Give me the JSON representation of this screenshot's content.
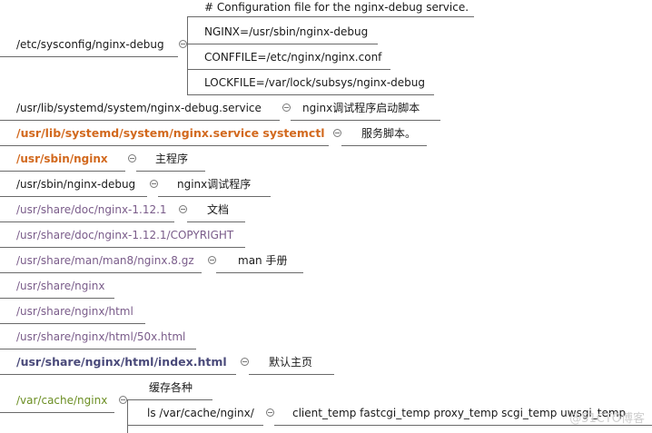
{
  "nodes": {
    "sysconfig": "/etc/sysconfig/nginx-debug",
    "config_comment": "# Configuration file for the nginx-debug service.",
    "nginx_var": "NGINX=/usr/sbin/nginx-debug",
    "conffile_var": "CONFFILE=/etc/nginx/nginx.conf",
    "lockfile_var": "LOCKFILE=/var/lock/subsys/nginx-debug",
    "debug_service": "/usr/lib/systemd/system/nginx-debug.service",
    "debug_service_note": "nginx调试程序启动脚本",
    "service": "/usr/lib/systemd/system/nginx.service systemctl",
    "service_note": "服务脚本。",
    "sbin_nginx": "/usr/sbin/nginx",
    "sbin_nginx_note": "主程序",
    "sbin_debug": "/usr/sbin/nginx-debug",
    "sbin_debug_note": "nginx调试程序",
    "doc": "/usr/share/doc/nginx-1.12.1",
    "doc_note": "文档",
    "copyright": "/usr/share/doc/nginx-1.12.1/COPYRIGHT",
    "man": "/usr/share/man/man8/nginx.8.gz",
    "man_note": "man 手册",
    "share_nginx": "/usr/share/nginx",
    "share_html": "/usr/share/nginx/html",
    "share_50x": "/usr/share/nginx/html/50x.html",
    "index": "/usr/share/nginx/html/index.html",
    "index_note": "默认主页",
    "cache": "/var/cache/nginx",
    "cache_note": "缓存各种",
    "cache_ls": "ls /var/cache/nginx/",
    "cache_dirs": "client_temp fastcgi_temp proxy_temp scgi_temp uwsgi_temp"
  },
  "watermark": "@51CTO博客",
  "colors": {
    "default": "#1a1a1a",
    "orange": "#d2691e",
    "purple": "#7a5c8a",
    "navy": "#4a4a7a",
    "green": "#6b8e23",
    "line": "#6a6a6a"
  }
}
